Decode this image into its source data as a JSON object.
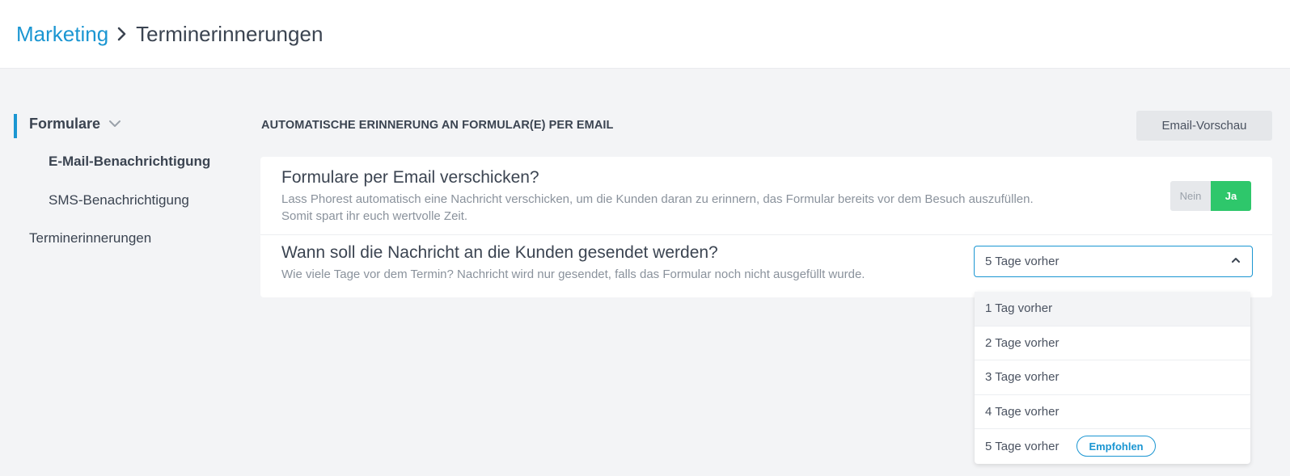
{
  "breadcrumb": {
    "parent": "Marketing",
    "current": "Terminerinnerungen"
  },
  "sidebar": {
    "group_label": "Formulare",
    "sub_items": [
      {
        "label": "E-Mail-Benachrichtigung",
        "active": true
      },
      {
        "label": "SMS-Benachrichtigung",
        "active": false
      }
    ],
    "items": [
      {
        "label": "Terminerinnerungen"
      }
    ]
  },
  "main": {
    "section_title": "AUTOMATISCHE ERINNERUNG AN FORMULAR(E) PER EMAIL",
    "preview_button": "Email-Vorschau",
    "send_question": {
      "title": "Formulare per Email verschicken?",
      "description": "Lass Phorest automatisch eine Nachricht verschicken, um die Kunden daran zu erinnern, das Formular bereits vor dem Besuch auszufüllen. Somit spart ihr euch wertvolle Zeit.",
      "toggle": {
        "no_label": "Nein",
        "yes_label": "Ja",
        "value": "Ja"
      }
    },
    "timing_question": {
      "title": "Wann soll die Nachricht an die Kunden gesendet werden?",
      "description": "Wie viele Tage vor dem Termin? Nachricht wird nur gesendet, falls das Formular noch nicht ausgefüllt wurde.",
      "selected": "5 Tage vorher",
      "options": [
        {
          "label": "1 Tag vorher"
        },
        {
          "label": "2 Tage vorher"
        },
        {
          "label": "3 Tage vorher"
        },
        {
          "label": "4 Tage vorher"
        },
        {
          "label": "5 Tage vorher",
          "badge": "Empfohlen"
        }
      ]
    }
  },
  "colors": {
    "accent": "#1b96d2",
    "toggle_on": "#2ec76b",
    "text": "#3b4451",
    "muted": "#8a929c"
  },
  "icons": {
    "breadcrumb_separator": "chevron-right-icon",
    "sidebar_group": "chevron-down-icon",
    "select_caret": "chevron-up-icon"
  }
}
